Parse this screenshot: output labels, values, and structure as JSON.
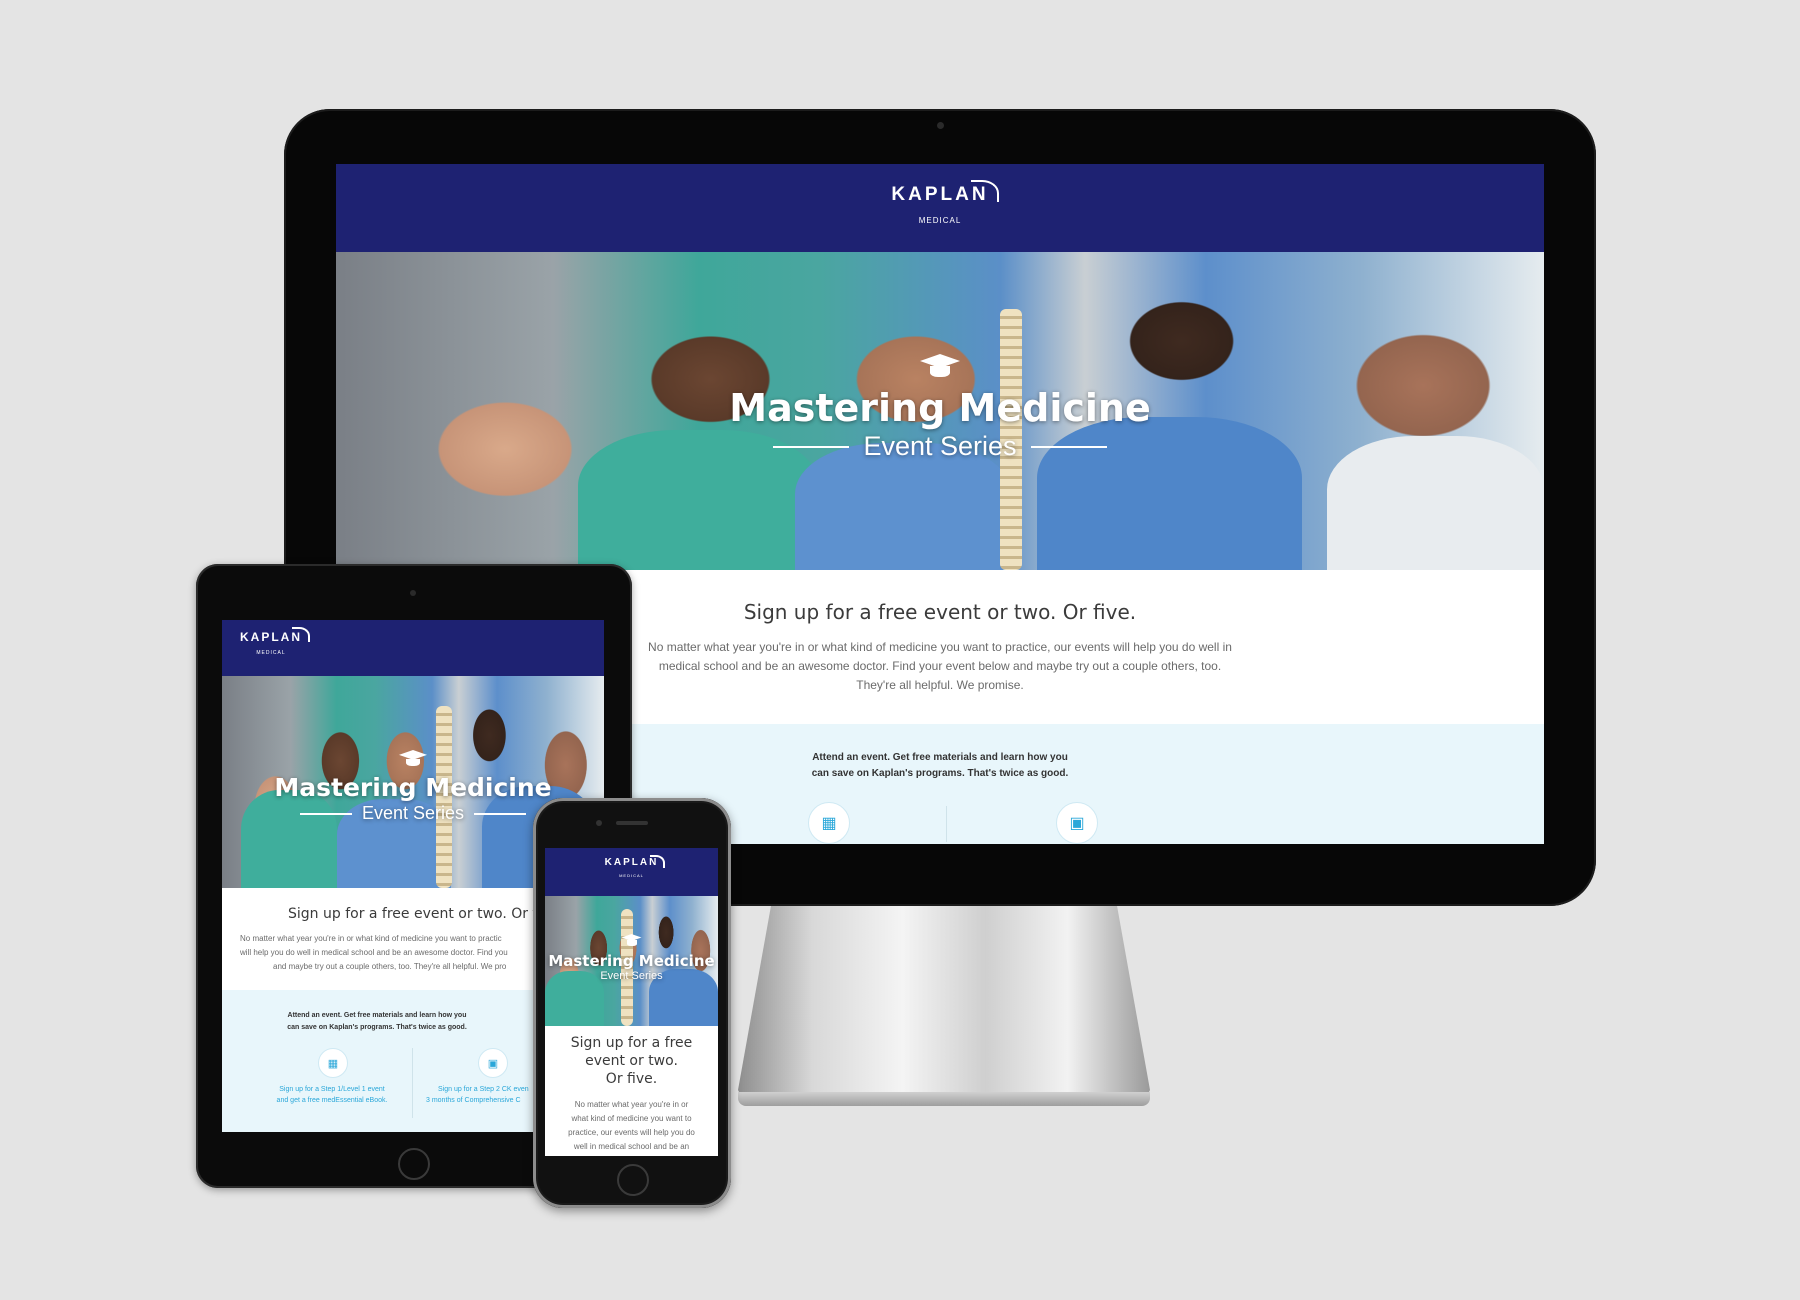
{
  "brand": {
    "name": "KAPLAN",
    "division": "MEDICAL"
  },
  "hero": {
    "title": "Mastering Medicine",
    "subtitle": "Event Series",
    "icon": "graduation-cap-icon"
  },
  "intro": {
    "heading": "Sign up for a free event or two. Or five.",
    "heading_phone_1": "Sign up for a free",
    "heading_phone_2": "event or two.",
    "heading_phone_3": "Or five.",
    "body_desktop_1": "No matter what year you're in or what kind of medicine you want to practice, our events will help you do well in",
    "body_desktop_2": "medical school and be an awesome doctor. Find your event below and maybe try out a couple others, too.",
    "body_desktop_3": "They're all helpful. We promise.",
    "body_tablet_1": "No matter what year you're in or what kind of medicine you want to practic",
    "body_tablet_2": "will help you do well in medical school and be an awesome doctor. Find you",
    "body_tablet_3": "and maybe try out a couple others, too. They're all helpful. We pro",
    "body_phone_1": "No matter what year you're in or",
    "body_phone_2": "what kind of medicine you want to",
    "body_phone_3": "practice, our events will help you do",
    "body_phone_4": "well in medical school and be an"
  },
  "band": {
    "line1": "Attend an event. Get free materials and learn how you",
    "line2": "can save on Kaplan's programs. That's twice as good.",
    "offer1_line1": "Sign up for a Step 1/Level 1 event",
    "offer1_line2": "and get a free medEssential eBook.",
    "offer2_line1": "Sign up for a Step 2 CK even",
    "offer2_line2": "3 months of Comprehensive C",
    "icon1": "book-icon",
    "icon2": "laptop-icon"
  },
  "colors": {
    "brand_navy": "#1e2272",
    "accent_blue": "#2aa7d9",
    "band_bg": "#e8f6fb"
  }
}
